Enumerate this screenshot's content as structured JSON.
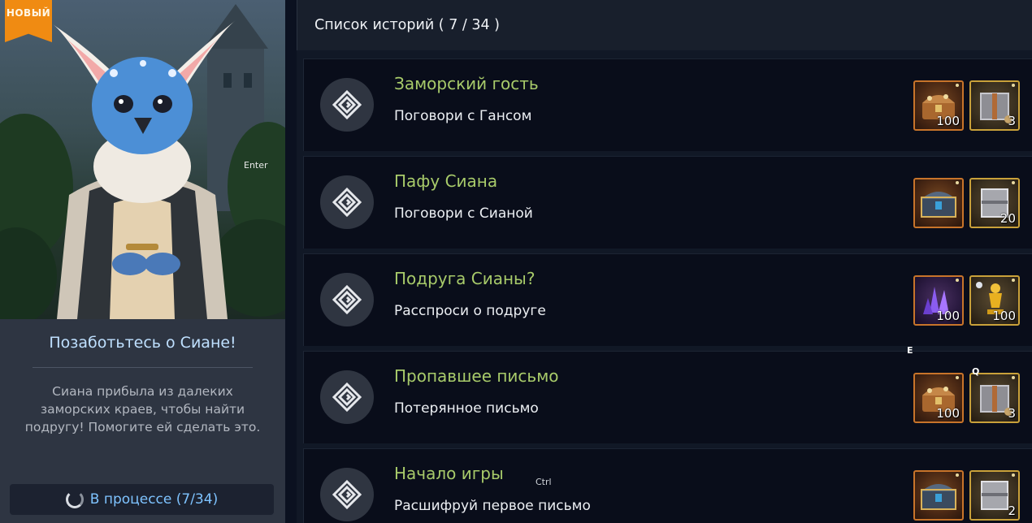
{
  "left": {
    "badge": "НОВЫЙ",
    "enter_hint": "Enter",
    "title": "Позаботьтесь о Сиане!",
    "description": "Сиана прибыла из далеких заморских краев, чтобы найти подругу! Помогите ей сделать это.",
    "progress": "В процессе (7/34)"
  },
  "list": {
    "header": "Список историй ( 7 / 34 )",
    "rows": [
      {
        "title": "Заморский гость",
        "subtitle": "Поговори с Гансом",
        "rewards": [
          {
            "icon": "treasure-chest-icon",
            "qty": "100"
          },
          {
            "icon": "gift-box-icon",
            "qty": "3"
          }
        ]
      },
      {
        "title": "Пафу Сиана",
        "subtitle": "Поговори с Сианой",
        "rewards": [
          {
            "icon": "blue-chest-icon",
            "qty": ""
          },
          {
            "icon": "silver-box-icon",
            "qty": "20"
          }
        ]
      },
      {
        "title": "Подруга Сианы?",
        "subtitle": "Расспроси о подруге",
        "rewards": [
          {
            "icon": "purple-crystal-icon",
            "qty": "100"
          },
          {
            "icon": "gold-trophy-icon",
            "qty": "100"
          }
        ]
      },
      {
        "title": "Пропавшее письмо",
        "subtitle": "Потерянное письмо",
        "rewards": [
          {
            "icon": "treasure-chest-icon",
            "qty": "100"
          },
          {
            "icon": "gift-box-icon",
            "qty": "3"
          }
        ]
      },
      {
        "title": "Начало игры",
        "subtitle": "Расшифруй первое письмо",
        "rewards": [
          {
            "icon": "blue-chest-icon",
            "qty": ""
          },
          {
            "icon": "silver-box-icon",
            "qty": "2"
          }
        ]
      }
    ]
  },
  "key_hints": {
    "e": "E",
    "q": "Q",
    "ctrl": "Ctrl"
  },
  "colors": {
    "title_green": "#a8cb6a",
    "header_blue": "#bfe0ff",
    "progress_blue": "#7ec3ff",
    "badge_orange": "#f08b12"
  }
}
